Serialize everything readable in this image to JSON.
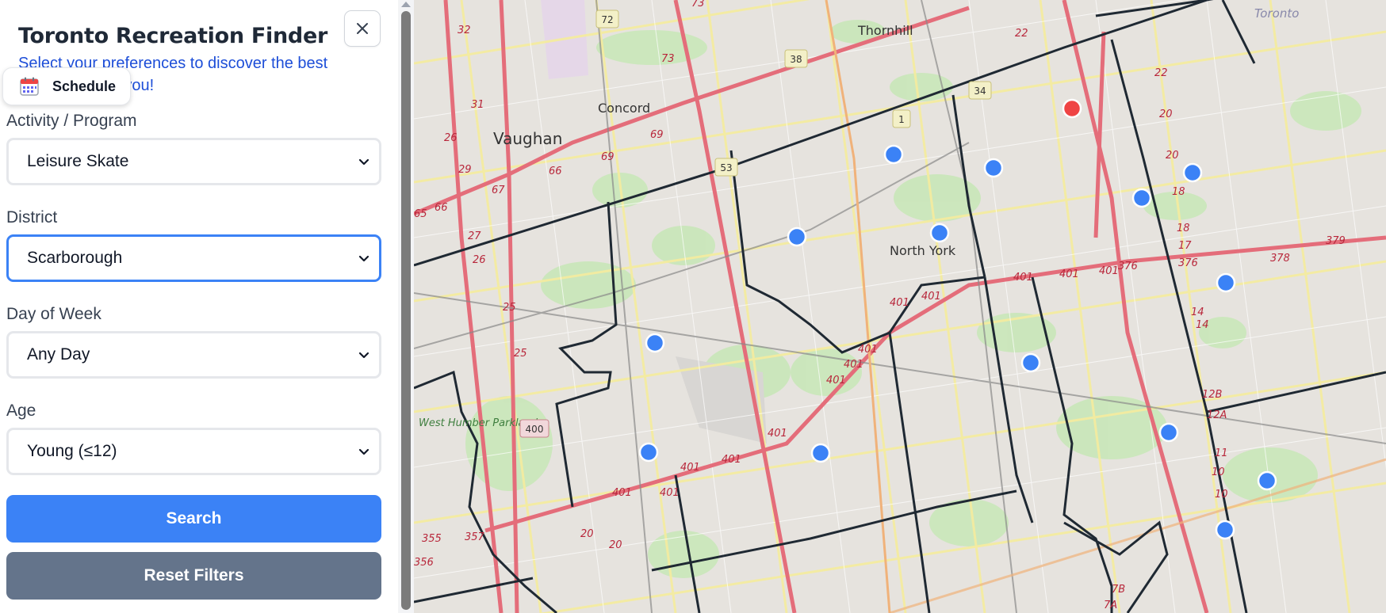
{
  "sidebar": {
    "title": "Toronto Recreation Finder",
    "subtitle": "Select your preferences to discover the best rec centres for you!",
    "schedule_label": "Schedule",
    "fields": [
      {
        "label": "Activity / Program",
        "value": "Leisure Skate"
      },
      {
        "label": "District",
        "value": "Scarborough"
      },
      {
        "label": "Day of Week",
        "value": "Any Day"
      },
      {
        "label": "Age",
        "value": "Young (≤12)"
      }
    ],
    "search_label": "Search",
    "reset_label": "Reset Filters"
  },
  "map": {
    "place_labels": [
      "Thornhill",
      "Concord",
      "Vaughan",
      "North York",
      "West Humber Parkland",
      "Toronto"
    ],
    "highway_shields": [
      "72",
      "38",
      "34",
      "53",
      "1",
      "400"
    ],
    "route_numbers": [
      "73",
      "73",
      "32",
      "31",
      "26",
      "29",
      "67",
      "66",
      "69",
      "69",
      "66",
      "65",
      "27",
      "26",
      "25",
      "25",
      "22",
      "22",
      "20",
      "20",
      "18",
      "18",
      "17",
      "14",
      "14",
      "12B",
      "12A",
      "11",
      "10",
      "10",
      "401",
      "401",
      "401",
      "401",
      "401",
      "401",
      "401",
      "401",
      "401",
      "401",
      "401",
      "401",
      "401",
      "355",
      "357",
      "356",
      "20",
      "20",
      "7B",
      "7A",
      "376",
      "376",
      "378",
      "379"
    ],
    "markers": [
      {
        "color": "#3b82f6"
      },
      {
        "color": "#3b82f6"
      },
      {
        "color": "#3b82f6"
      },
      {
        "color": "#3b82f6"
      },
      {
        "color": "#3b82f6"
      },
      {
        "color": "#3b82f6"
      },
      {
        "color": "#3b82f6"
      },
      {
        "color": "#3b82f6"
      },
      {
        "color": "#3b82f6"
      },
      {
        "color": "#3b82f6"
      },
      {
        "color": "#3b82f6"
      },
      {
        "color": "#3b82f6"
      },
      {
        "color": "#3b82f6"
      },
      {
        "color": "#3b82f6"
      },
      {
        "color": "#ef4444"
      }
    ]
  },
  "colors": {
    "primary": "#3b82f6",
    "reset": "#64748b",
    "title": "#1f2937",
    "subtitle": "#1d4ed8",
    "selected_marker": "#ef4444"
  }
}
